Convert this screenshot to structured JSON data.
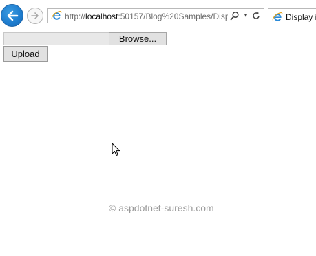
{
  "browser": {
    "url_prefix": "http://",
    "url_host": "localhost",
    "url_rest": ":50157/Blog%20Samples/Disp",
    "tab_title": "Display i",
    "dropdown_glyph": "▾"
  },
  "page": {
    "browse_label": "Browse...",
    "upload_label": "Upload",
    "file_path_value": ""
  },
  "watermark": {
    "text": "© aspdotnet-suresh.com"
  },
  "colors": {
    "back_button": "#1f7ed0",
    "ie_icon": "#2a8ad8",
    "button_face": "#e1e1e1",
    "watermark": "#9a9a9a"
  },
  "icons": [
    "back-arrow-icon",
    "forward-arrow-icon",
    "ie-logo-icon",
    "search-icon",
    "dropdown-icon",
    "refresh-icon",
    "mouse-cursor-icon"
  ]
}
